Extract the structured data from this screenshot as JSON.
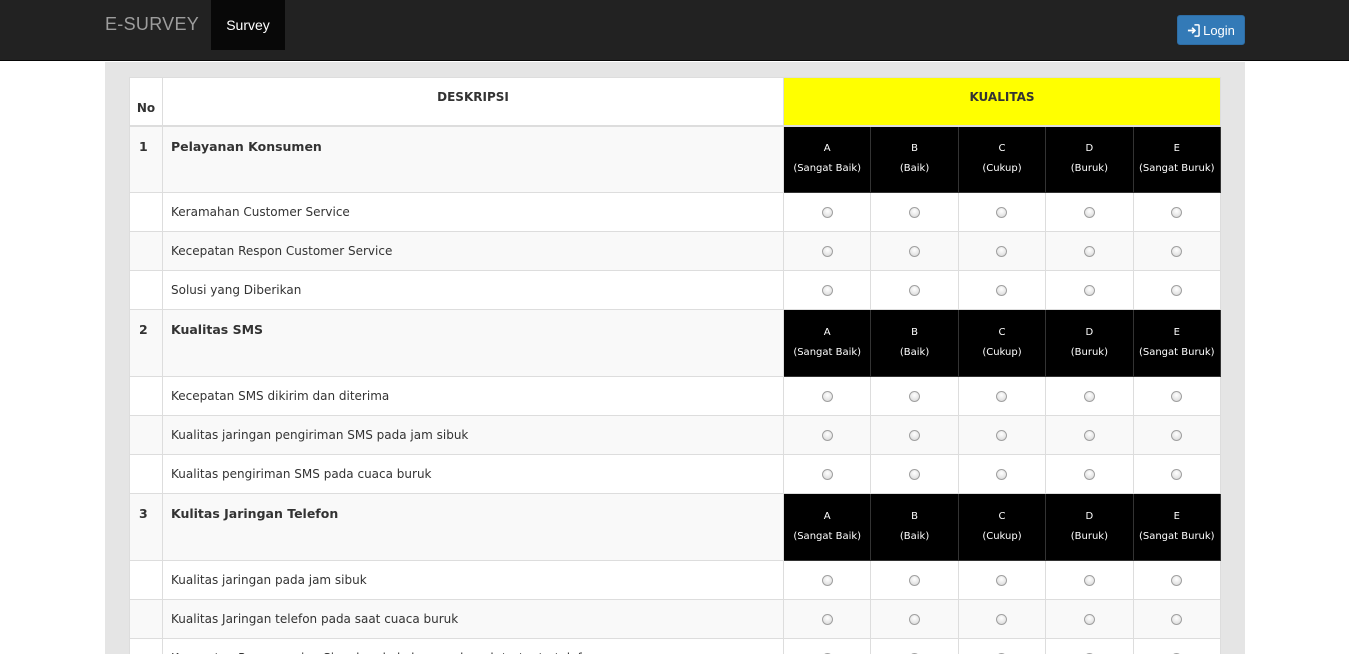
{
  "navbar": {
    "brand": "E-SURVEY",
    "tab_label": "Survey",
    "login_label": "Login"
  },
  "table": {
    "headers": {
      "no": "No",
      "deskripsi": "DESKRIPSI",
      "kualitas": "KUALITAS"
    },
    "grades": [
      {
        "letter": "A",
        "label": "(Sangat Baik)"
      },
      {
        "letter": "B",
        "label": "(Baik)"
      },
      {
        "letter": "C",
        "label": "(Cukup)"
      },
      {
        "letter": "D",
        "label": "(Buruk)"
      },
      {
        "letter": "E",
        "label": "(Sangat Buruk)"
      }
    ],
    "sections": [
      {
        "num": "1",
        "title": "Pelayanan Konsumen",
        "items": [
          "Keramahan Customer Service",
          "Kecepatan Respon Customer Service",
          "Solusi yang Diberikan"
        ]
      },
      {
        "num": "2",
        "title": "Kualitas SMS",
        "items": [
          "Kecepatan SMS dikirim dan diterima",
          "Kualitas jaringan pengiriman SMS pada jam sibuk",
          "Kualitas pengiriman SMS pada cuaca buruk"
        ]
      },
      {
        "num": "3",
        "title": "Kulitas Jaringan Telefon",
        "items": [
          "Kualitas jaringan pada jam sibuk",
          "Kualitas Jaringan telefon pada saat cuaca buruk",
          "Kecepatan Penyampaian Sinyal pada kalangan daerah tertentu telefon"
        ]
      }
    ]
  }
}
